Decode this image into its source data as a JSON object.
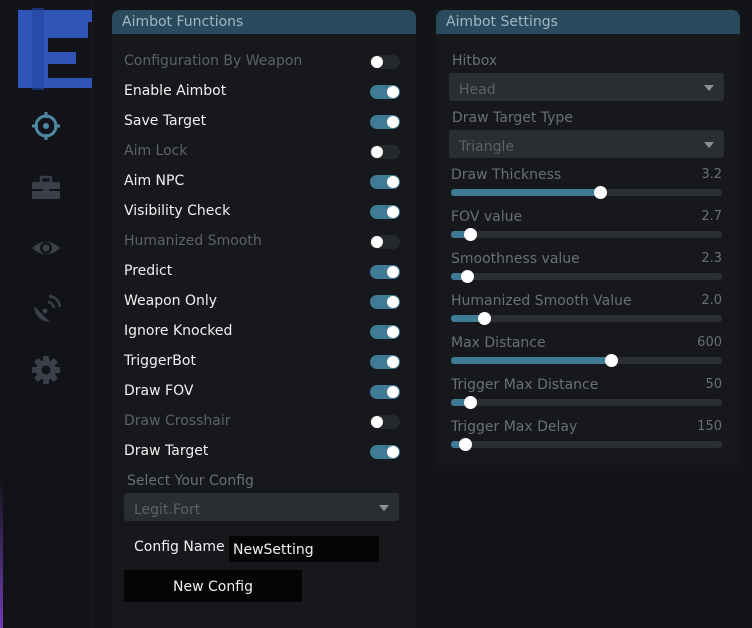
{
  "colors": {
    "accent": "#3f7b95",
    "logo": "#2f55b8",
    "header": "#2a4a5e",
    "icon": "#4f88a3"
  },
  "sidebar": {
    "icons": [
      "crosshair-icon",
      "toolbox-icon",
      "eye-icon",
      "satellite-icon",
      "gear-icon"
    ]
  },
  "aimbot_functions": {
    "title": "Aimbot Functions",
    "toggles": [
      {
        "label": "Configuration By Weapon",
        "on": false,
        "enabled": false
      },
      {
        "label": "Enable Aimbot",
        "on": true,
        "enabled": true
      },
      {
        "label": "Save Target",
        "on": true,
        "enabled": true
      },
      {
        "label": "Aim Lock",
        "on": false,
        "enabled": false
      },
      {
        "label": "Aim NPC",
        "on": true,
        "enabled": true
      },
      {
        "label": "Visibility Check",
        "on": true,
        "enabled": true
      },
      {
        "label": "Humanized Smooth",
        "on": false,
        "enabled": false
      },
      {
        "label": "Predict",
        "on": true,
        "enabled": true
      },
      {
        "label": "Weapon Only",
        "on": true,
        "enabled": true
      },
      {
        "label": "Ignore Knocked",
        "on": true,
        "enabled": true
      },
      {
        "label": "TriggerBot",
        "on": true,
        "enabled": true
      },
      {
        "label": "Draw FOV",
        "on": true,
        "enabled": true
      },
      {
        "label": "Draw Crosshair",
        "on": false,
        "enabled": false
      },
      {
        "label": "Draw Target",
        "on": true,
        "enabled": true
      }
    ],
    "select_config_label": "Select Your Config",
    "select_config_value": "Legit.Fort",
    "config_name_label": "Config Name",
    "config_name_value": "NewSetting",
    "new_config_label": "New Config"
  },
  "aimbot_settings": {
    "title": "Aimbot Settings",
    "hitbox_label": "Hitbox",
    "hitbox_value": "Head",
    "draw_target_type_label": "Draw Target Type",
    "draw_target_type_value": "Triangle",
    "sliders": [
      {
        "label": "Draw Thickness",
        "value": "3.2",
        "fraction": 0.55
      },
      {
        "label": "FOV value",
        "value": "2.7",
        "fraction": 0.07
      },
      {
        "label": "Smoothness value",
        "value": "2.3",
        "fraction": 0.06
      },
      {
        "label": "Humanized Smooth Value",
        "value": "2.0",
        "fraction": 0.12
      },
      {
        "label": "Max Distance",
        "value": "600",
        "fraction": 0.59
      },
      {
        "label": "Trigger Max Distance",
        "value": "50",
        "fraction": 0.07
      },
      {
        "label": "Trigger Max Delay",
        "value": "150",
        "fraction": 0.05
      }
    ]
  }
}
